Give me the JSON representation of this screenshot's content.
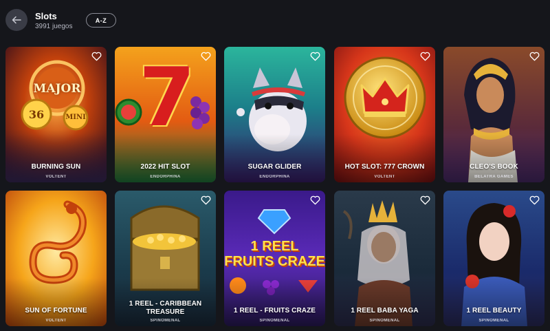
{
  "header": {
    "title": "Slots",
    "count": "3991 juegos",
    "sort_label": "A-Z",
    "back_icon": "arrow-left-icon"
  },
  "games": [
    {
      "name": "BURNING SUN",
      "provider": "VOLTENT"
    },
    {
      "name": "2022 HIT SLOT",
      "provider": "ENDORPHINA"
    },
    {
      "name": "SUGAR GLIDER",
      "provider": "ENDORPHINA"
    },
    {
      "name": "HOT SLOT: 777 CROWN",
      "provider": "VOLTENT"
    },
    {
      "name": "CLEO'S BOOK",
      "provider": "BELATRA GAMES"
    },
    {
      "name": "SUN OF FORTUNE",
      "provider": "VOLTENT"
    },
    {
      "name": "1 REEL - CARIBBEAN TREASURE",
      "provider": "SPINOMENAL"
    },
    {
      "name": "1 REEL - FRUITS CRAZE",
      "provider": "SPINOMENAL"
    },
    {
      "name": "1 REEL BABA YAGA",
      "provider": "SPINOMENAL"
    },
    {
      "name": "1 REEL BEAUTY",
      "provider": "SPINOMENAL"
    }
  ],
  "art_text": {
    "major": "MAJOR",
    "mini": "MINI",
    "num": "36",
    "seven": "7",
    "fruits_line1": "1 REEL",
    "fruits_line2": "FRUITS CRAZE"
  },
  "icons": {
    "favorite": "heart-outline-icon"
  }
}
